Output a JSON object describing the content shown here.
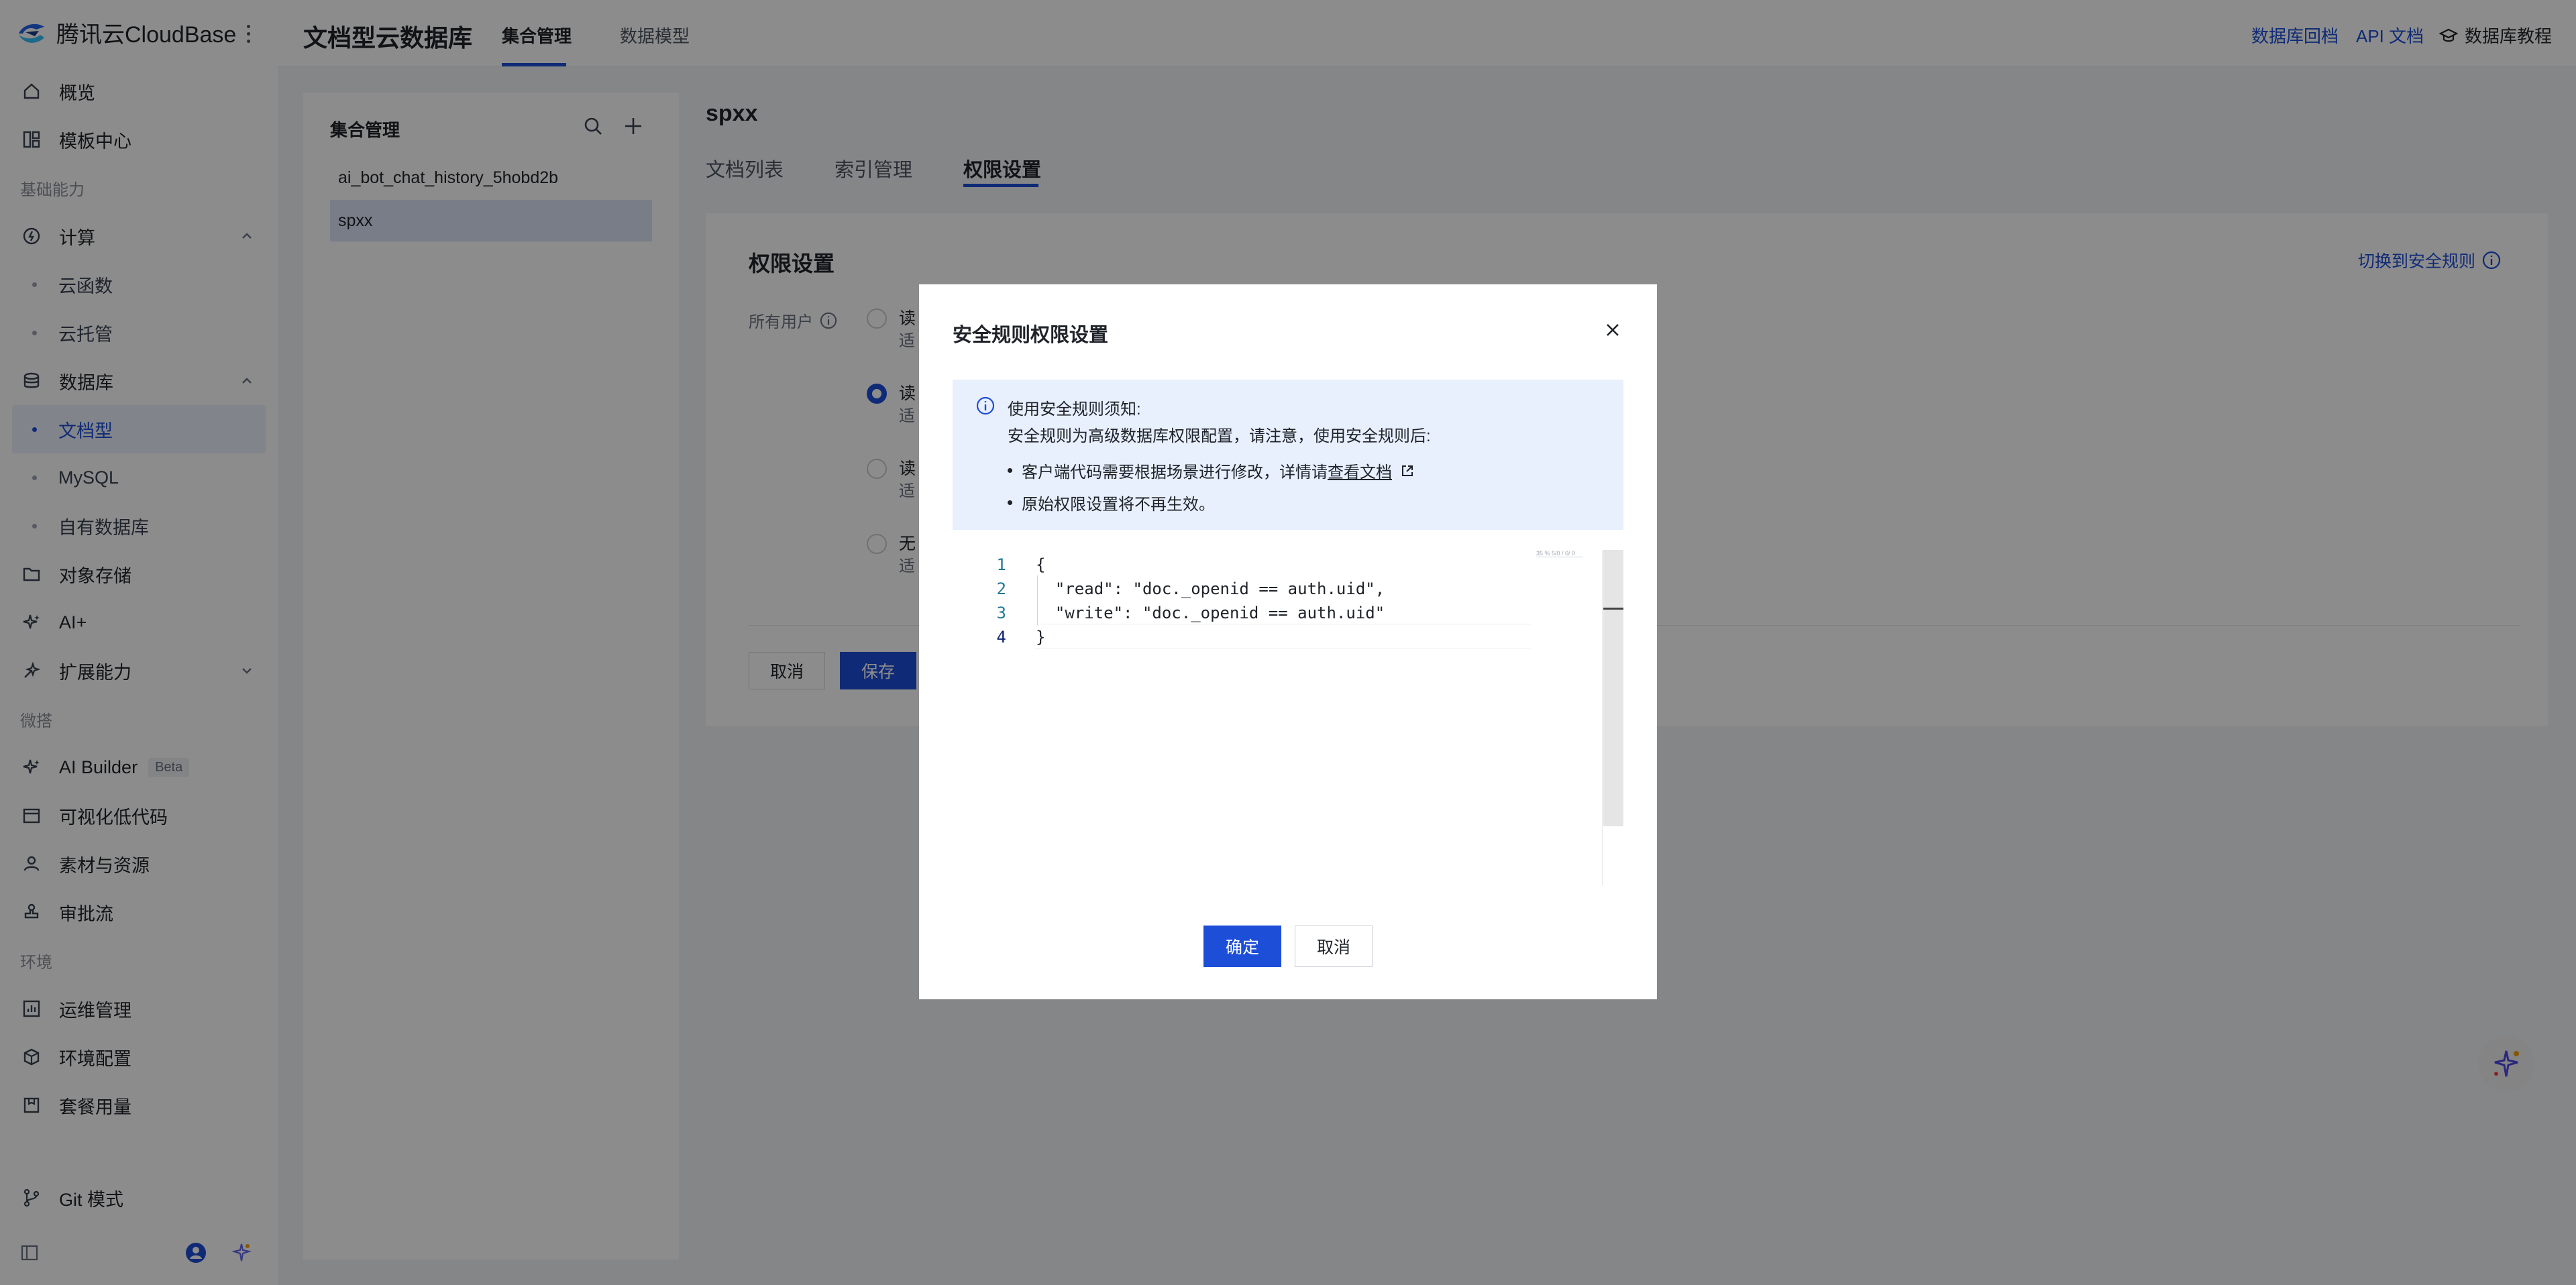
{
  "app": {
    "brand_name": "腾讯云CloudBase"
  },
  "sidebar": {
    "items": [
      {
        "label": "概览"
      },
      {
        "label": "模板中心"
      }
    ],
    "group_basic": "基础能力",
    "compute": "计算",
    "compute_children": [
      "云函数",
      "云托管"
    ],
    "database": "数据库",
    "database_children": [
      "文档型",
      "MySQL",
      "自有数据库"
    ],
    "object_storage": "对象存储",
    "ai_plus": "AI+",
    "extensions": "扩展能力",
    "group_build": "微搭",
    "ai_builder": "AI Builder",
    "beta": "Beta",
    "lowcode": "可视化低代码",
    "assets": "素材与资源",
    "approval": "审批流",
    "group_env": "环境",
    "ops": "运维管理",
    "env_config": "环境配置",
    "plan_usage": "套餐用量",
    "git_mode": "Git 模式"
  },
  "header": {
    "title": "文档型云数据库",
    "tabs": [
      {
        "label": "集合管理"
      },
      {
        "label": "数据模型"
      }
    ],
    "links": {
      "rollback": "数据库回档",
      "api_docs": "API 文档",
      "tutorial": "数据库教程"
    }
  },
  "collections": {
    "title": "集合管理",
    "items": [
      {
        "name": "ai_bot_chat_history_5hobd2b"
      },
      {
        "name": "spxx"
      }
    ]
  },
  "detail": {
    "title": "spxx",
    "tabs": [
      {
        "label": "文档列表"
      },
      {
        "label": "索引管理"
      },
      {
        "label": "权限设置"
      }
    ],
    "heading": "权限设置",
    "switch_rules": "切换到安全规则",
    "all_users": "所有用户",
    "radio_labels": [
      "读",
      "读",
      "读",
      "无"
    ],
    "radio_subs": [
      "适",
      "适",
      "适",
      "适"
    ],
    "cancel": "取消",
    "save": "保存"
  },
  "modal": {
    "title": "安全规则权限设置",
    "notice_title": "使用安全规则须知:",
    "notice_line": "安全规则为高级数据库权限配置，请注意，使用安全规则后:",
    "bullet1_prefix": "客户端代码需要根据场景进行修改，详情请",
    "bullet1_link": "查看文档",
    "bullet2": "原始权限设置将不再生效。",
    "code_lines": [
      "{",
      "  \"read\": \"doc._openid == auth.uid\",",
      "  \"write\": \"doc._openid == auth.uid\"",
      "}"
    ],
    "line_numbers": [
      "1",
      "2",
      "3",
      "4"
    ],
    "minimap_text": "35 % 5/0 / 0/ 0",
    "ok": "确定",
    "cancel": "取消"
  },
  "colors": {
    "accent": "#1d4ed8",
    "notice_bg": "#e8effd",
    "overlay": "rgba(0,0,0,0.45)"
  }
}
